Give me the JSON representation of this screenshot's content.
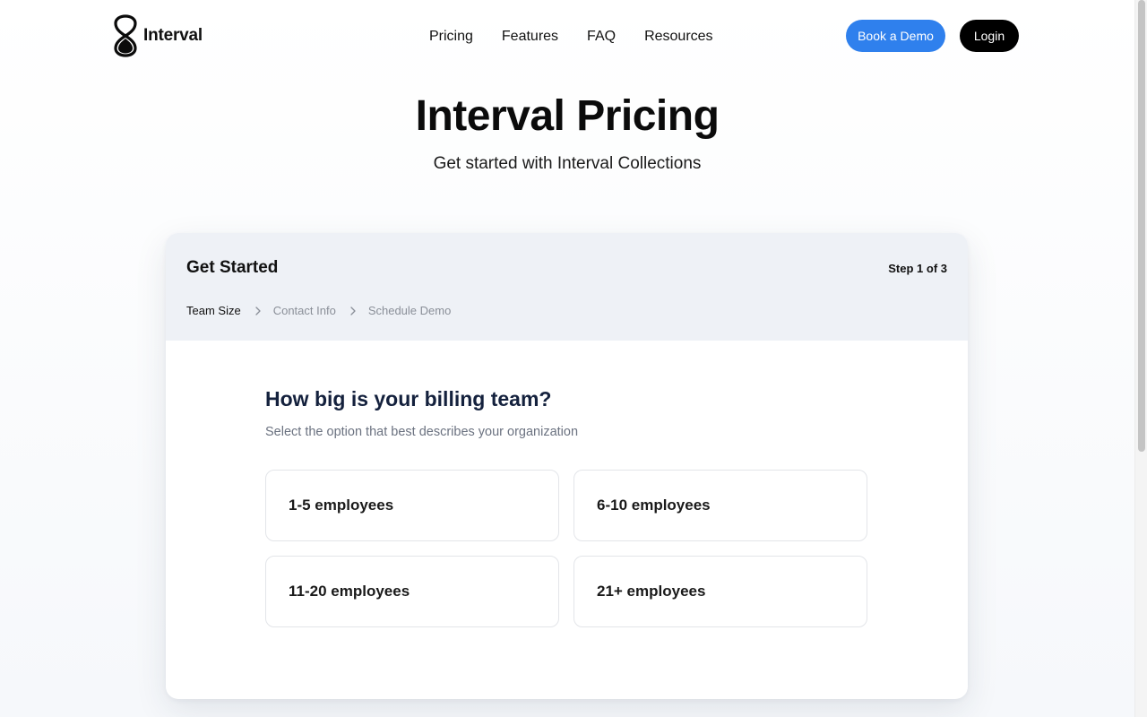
{
  "header": {
    "brand_name": "Interval",
    "nav": [
      "Pricing",
      "Features",
      "FAQ",
      "Resources"
    ],
    "book_demo_label": "Book a Demo",
    "login_label": "Login"
  },
  "hero": {
    "title": "Interval Pricing",
    "subtitle": "Get started with Interval Collections"
  },
  "card": {
    "title": "Get Started",
    "step_indicator": "Step 1 of 3",
    "steps": [
      "Team Size",
      "Contact Info",
      "Schedule Demo"
    ],
    "question": "How big is your billing team?",
    "hint": "Select the option that best describes your organization",
    "options": [
      "1-5 employees",
      "6-10 employees",
      "11-20 employees",
      "21+ employees"
    ]
  },
  "colors": {
    "accent": "#2f80ed",
    "login_bg": "#000000",
    "card_header_bg": "#eef1f6",
    "question_color": "#14213d",
    "muted_text": "#8a8f98"
  },
  "icons": {
    "logo": "hourglass-logo-icon",
    "step_separator": "chevron-right-icon"
  }
}
